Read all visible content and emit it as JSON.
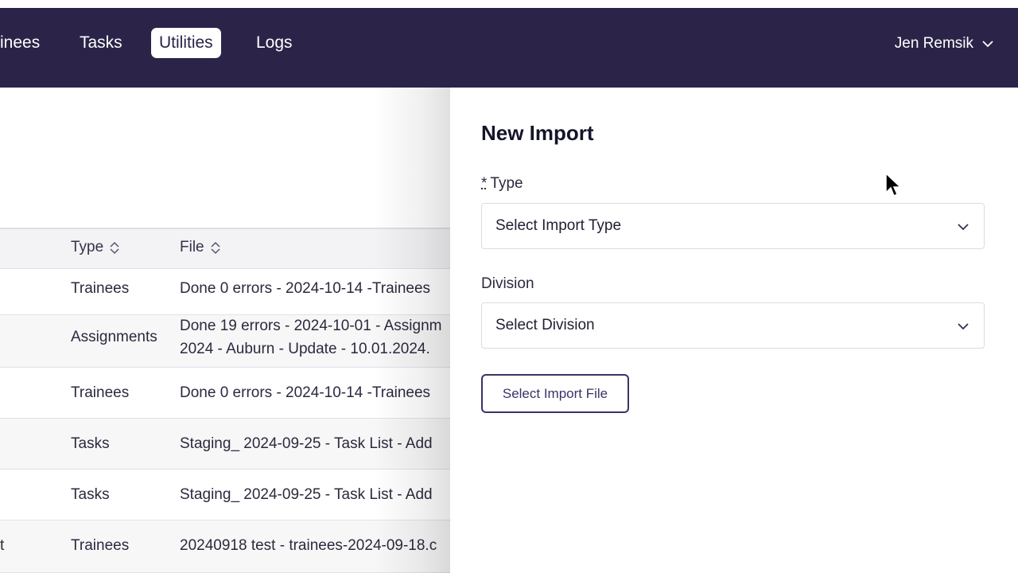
{
  "nav": {
    "items": [
      {
        "label": "inees",
        "active": false
      },
      {
        "label": "Tasks",
        "active": false
      },
      {
        "label": "Utilities",
        "active": true
      },
      {
        "label": "Logs",
        "active": false
      }
    ],
    "user": "Jen Remsik"
  },
  "table": {
    "columns": [
      "Type",
      "File"
    ],
    "rows": [
      {
        "edge": "",
        "type": "Trainees",
        "file": [
          "Done 0 errors - 2024-10-14 -Trainees"
        ]
      },
      {
        "edge": "",
        "type": "Assignments",
        "file": [
          "Done 19 errors - 2024-10-01 - Assignm",
          "2024 - Auburn - Update - 10.01.2024."
        ]
      },
      {
        "edge": "",
        "type": "Trainees",
        "file": [
          "Done 0 errors - 2024-10-14 -Trainees"
        ]
      },
      {
        "edge": "",
        "type": "Tasks",
        "file": [
          "Staging_ 2024-09-25 - Task List - Add"
        ]
      },
      {
        "edge": "",
        "type": "Tasks",
        "file": [
          "Staging_ 2024-09-25 - Task List - Add"
        ]
      },
      {
        "edge": "t",
        "type": "Trainees",
        "file": [
          "20240918 test - trainees-2024-09-18.c"
        ]
      }
    ]
  },
  "panel": {
    "title": "New Import",
    "type_required_mark": "*",
    "type_label": "Type",
    "type_select": "Select Import Type",
    "division_label": "Division",
    "division_select": "Select Division",
    "file_button": "Select Import File"
  },
  "colors": {
    "navbar": "#2b2448",
    "accent": "#3a3366"
  },
  "icons": {
    "user_menu": "chevron-down-icon",
    "sort": "sort-updown-icon",
    "select": "chevron-down-icon",
    "cursor": "mouse-pointer-icon"
  }
}
